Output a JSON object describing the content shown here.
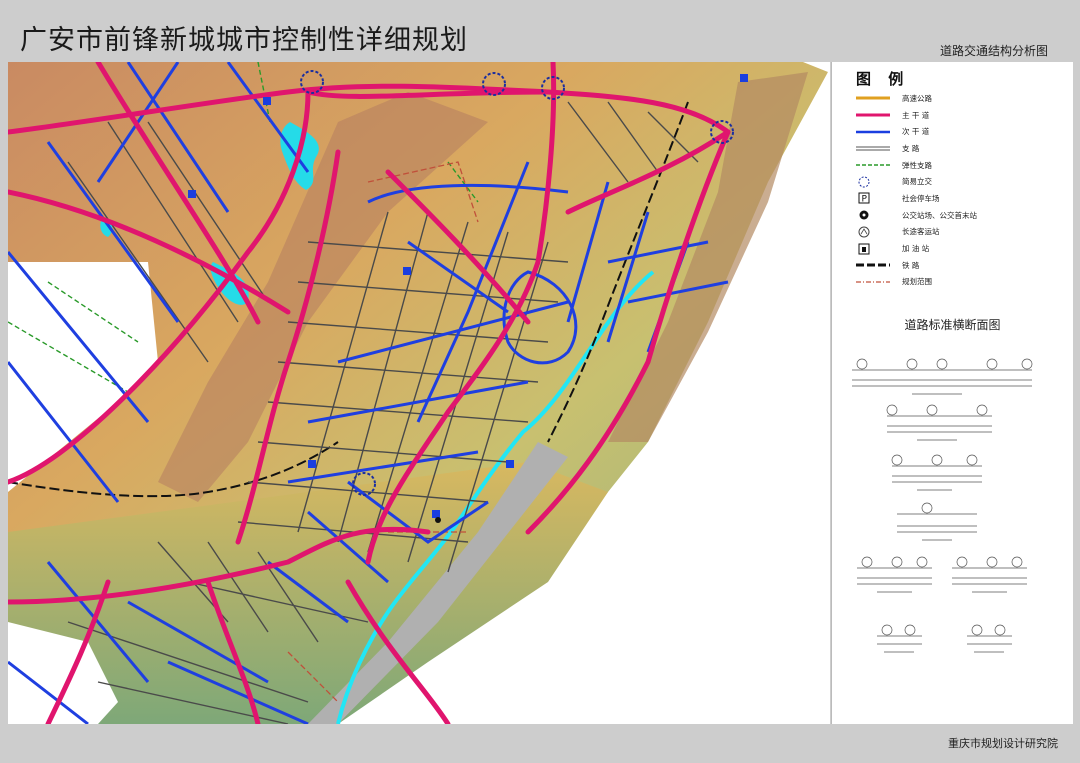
{
  "title": "广安市前锋新城城市控制性详细规划",
  "subtitle": "道路交通结构分析图",
  "footer": "重庆市规划设计研究院",
  "legend": {
    "title": "图 例",
    "items": [
      {
        "label": "高速公路",
        "icon": "expressway-line",
        "color": "#e0a020"
      },
      {
        "label": "主 干 道",
        "icon": "arterial-road-line",
        "color": "#e0156e"
      },
      {
        "label": "次 干 道",
        "icon": "secondary-road-line",
        "color": "#1a3ee0"
      },
      {
        "label": "支    路",
        "icon": "branch-road-line",
        "color": "#555555"
      },
      {
        "label": "弹性支路",
        "icon": "flexible-road-dashed-line",
        "color": "#2a9a2a"
      },
      {
        "label": "简易立交",
        "icon": "interchange-circle-icon",
        "color": "#1a2ea0"
      },
      {
        "label": "社会停车场",
        "icon": "parking-icon",
        "color": "#111111"
      },
      {
        "label": "公交站场、公交首末站",
        "icon": "bus-terminal-icon",
        "color": "#111111"
      },
      {
        "label": "长途客运站",
        "icon": "coach-station-icon",
        "color": "#444444"
      },
      {
        "label": "加 油 站",
        "icon": "gas-station-icon",
        "color": "#111111"
      },
      {
        "label": "铁    路",
        "icon": "railway-line",
        "color": "#111111"
      },
      {
        "label": "规划范围",
        "icon": "planning-boundary-line",
        "color": "#c0503a"
      }
    ]
  },
  "sections_title": "道路标准横断面图",
  "colors": {
    "arterial": "#e0156e",
    "secondary": "#1f3fe0",
    "branch": "#4a4a4a",
    "river": "#22e0f0",
    "flexible": "#2a9a2a",
    "boundary": "#c0503a"
  }
}
